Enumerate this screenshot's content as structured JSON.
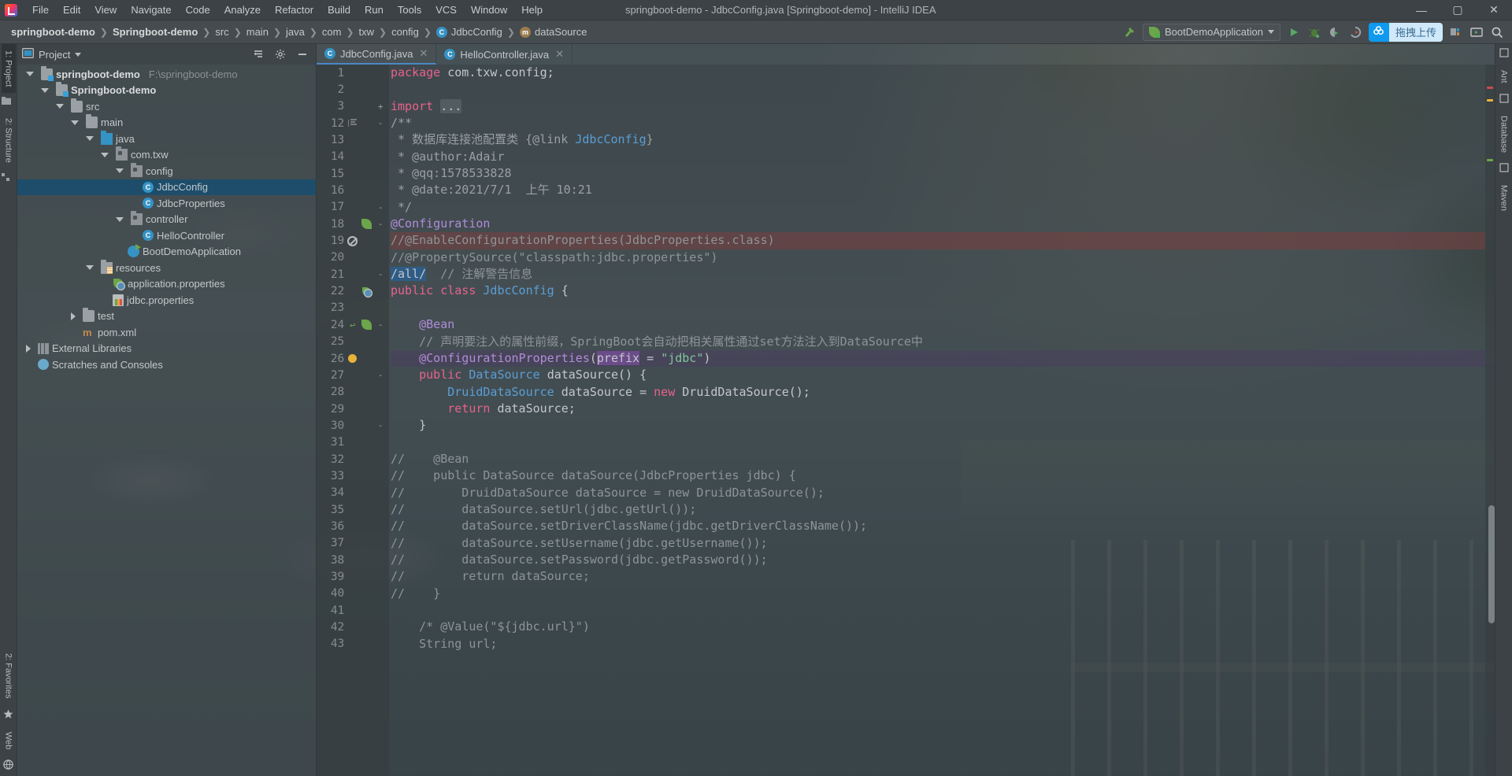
{
  "window": {
    "title": "springboot-demo - JdbcConfig.java [Springboot-demo] - IntelliJ IDEA",
    "minimize": "—",
    "maximize": "▢",
    "close": "✕"
  },
  "menu": [
    {
      "label": "File"
    },
    {
      "label": "Edit"
    },
    {
      "label": "View"
    },
    {
      "label": "Navigate"
    },
    {
      "label": "Code"
    },
    {
      "label": "Analyze"
    },
    {
      "label": "Refactor"
    },
    {
      "label": "Build"
    },
    {
      "label": "Run"
    },
    {
      "label": "Tools"
    },
    {
      "label": "VCS"
    },
    {
      "label": "Window"
    },
    {
      "label": "Help"
    }
  ],
  "breadcrumb": [
    {
      "label": "springboot-demo",
      "icon": "none",
      "bold": true
    },
    {
      "label": "Springboot-demo",
      "icon": "none",
      "bold": true
    },
    {
      "label": "src",
      "icon": "none",
      "bold": false
    },
    {
      "label": "main",
      "icon": "none",
      "bold": false
    },
    {
      "label": "java",
      "icon": "none",
      "bold": false
    },
    {
      "label": "com",
      "icon": "none",
      "bold": false
    },
    {
      "label": "txw",
      "icon": "none",
      "bold": false
    },
    {
      "label": "config",
      "icon": "none",
      "bold": false
    },
    {
      "label": "JdbcConfig",
      "icon": "class-icon",
      "bold": false
    },
    {
      "label": "dataSource",
      "icon": "method-icon",
      "bold": false
    }
  ],
  "toolbar": {
    "build_icon": "hammer-icon",
    "run_config": "BootDemoApplication",
    "run_icon": "run-icon",
    "debug_icon": "debug-icon",
    "coverage_icon": "coverage-icon",
    "profile_icon": "profile-icon",
    "upload_badge": "拖拽上传",
    "upload_icon": "cloud-upload-icon",
    "project_structure_icon": "project-structure-icon",
    "updates_icon": "updates-icon",
    "search_icon": "search-icon"
  },
  "left_rail": {
    "top": [
      {
        "label": "1: Project",
        "active": true,
        "icon": "project-icon"
      },
      {
        "label": "2: Structure",
        "active": false,
        "icon": "structure-icon"
      }
    ],
    "bottom": [
      {
        "label": "2: Favorites",
        "icon": "star-icon"
      },
      {
        "label": "Web",
        "icon": "globe-icon"
      }
    ]
  },
  "right_rail": {
    "items": [
      {
        "label": "Ant",
        "icon": "ant-icon"
      },
      {
        "label": "Database",
        "icon": "database-icon"
      },
      {
        "label": "Maven",
        "icon": "maven-icon"
      }
    ]
  },
  "project_panel": {
    "header": {
      "title": "Project",
      "dropdown_icon": "chevron-down-icon",
      "collapse_icon": "collapse-all-icon",
      "settings_icon": "gear-icon",
      "hide_icon": "hide-icon"
    },
    "tree": [
      {
        "depth": 0,
        "label": "springboot-demo",
        "path": "F:\\springboot-demo",
        "icon": "module-folder-icon",
        "twisty": "open",
        "bold": true,
        "selected": false
      },
      {
        "depth": 1,
        "label": "Springboot-demo",
        "path": "",
        "icon": "module-folder-icon",
        "twisty": "open",
        "bold": true,
        "selected": false
      },
      {
        "depth": 2,
        "label": "src",
        "path": "",
        "icon": "folder-icon",
        "twisty": "open",
        "bold": false,
        "selected": false
      },
      {
        "depth": 3,
        "label": "main",
        "path": "",
        "icon": "folder-icon",
        "twisty": "open",
        "bold": false,
        "selected": false
      },
      {
        "depth": 4,
        "label": "java",
        "path": "",
        "icon": "source-folder-icon",
        "twisty": "open",
        "bold": false,
        "selected": false
      },
      {
        "depth": 5,
        "label": "com.txw",
        "path": "",
        "icon": "package-icon",
        "twisty": "open",
        "bold": false,
        "selected": false
      },
      {
        "depth": 6,
        "label": "config",
        "path": "",
        "icon": "package-icon",
        "twisty": "open",
        "bold": false,
        "selected": false
      },
      {
        "depth": 7,
        "label": "JdbcConfig",
        "path": "",
        "icon": "class-icon",
        "twisty": "none",
        "bold": false,
        "selected": true
      },
      {
        "depth": 7,
        "label": "JdbcProperties",
        "path": "",
        "icon": "class-icon",
        "twisty": "none",
        "bold": false,
        "selected": false
      },
      {
        "depth": 6,
        "label": "controller",
        "path": "",
        "icon": "package-icon",
        "twisty": "open",
        "bold": false,
        "selected": false
      },
      {
        "depth": 7,
        "label": "HelloController",
        "path": "",
        "icon": "class-icon",
        "twisty": "none",
        "bold": false,
        "selected": false
      },
      {
        "depth": 6,
        "label": "BootDemoApplication",
        "path": "",
        "icon": "springboot-app-icon",
        "twisty": "none",
        "bold": false,
        "selected": false
      },
      {
        "depth": 4,
        "label": "resources",
        "path": "",
        "icon": "resources-folder-icon",
        "twisty": "open",
        "bold": false,
        "selected": false
      },
      {
        "depth": 5,
        "label": "application.properties",
        "path": "",
        "icon": "spring-props-icon",
        "twisty": "none",
        "bold": false,
        "selected": false
      },
      {
        "depth": 5,
        "label": "jdbc.properties",
        "path": "",
        "icon": "properties-icon",
        "twisty": "none",
        "bold": false,
        "selected": false
      },
      {
        "depth": 3,
        "label": "test",
        "path": "",
        "icon": "folder-icon",
        "twisty": "closed",
        "bold": false,
        "selected": false
      },
      {
        "depth": 3,
        "label": "pom.xml",
        "path": "",
        "icon": "maven-icon",
        "twisty": "none",
        "bold": false,
        "selected": false
      },
      {
        "depth": 0,
        "label": "External Libraries",
        "path": "",
        "icon": "library-icon",
        "twisty": "closed",
        "bold": false,
        "selected": false
      },
      {
        "depth": 0,
        "label": "Scratches and Consoles",
        "path": "",
        "icon": "scratch-icon",
        "twisty": "none",
        "bold": false,
        "selected": false
      }
    ]
  },
  "editor": {
    "tabs": [
      {
        "label": "JdbcConfig.java",
        "active": true,
        "icon": "class-icon",
        "close": "✕"
      },
      {
        "label": "HelloController.java",
        "active": false,
        "icon": "class-icon",
        "close": "✕"
      }
    ],
    "lines": [
      {
        "num": "1",
        "marks": [],
        "fold": "",
        "hl": "",
        "tokens": [
          {
            "t": "package ",
            "c": "kw"
          },
          {
            "t": "com.txw.config;",
            "c": "fn"
          }
        ]
      },
      {
        "num": "2",
        "marks": [],
        "fold": "",
        "hl": "",
        "tokens": []
      },
      {
        "num": "3",
        "marks": [],
        "fold": "+",
        "hl": "",
        "tokens": [
          {
            "t": "import ",
            "c": "kw"
          },
          {
            "t": "...",
            "c": "folded"
          }
        ]
      },
      {
        "num": "12",
        "marks": [
          "doc-align"
        ],
        "fold": "-",
        "hl": "",
        "tokens": [
          {
            "t": "/**",
            "c": "cmt-doc"
          }
        ]
      },
      {
        "num": "13",
        "marks": [],
        "fold": "",
        "hl": "",
        "tokens": [
          {
            "t": " * ",
            "c": "cmt-doc"
          },
          {
            "t": "数据库连接池配置类 ",
            "c": "cmt-doc"
          },
          {
            "t": "{@link ",
            "c": "cmt-doc"
          },
          {
            "t": "JdbcConfig",
            "c": "cls"
          },
          {
            "t": "}",
            "c": "cmt-doc"
          }
        ]
      },
      {
        "num": "14",
        "marks": [],
        "fold": "",
        "hl": "",
        "tokens": [
          {
            "t": " * @author:Adair",
            "c": "cmt-doc"
          }
        ]
      },
      {
        "num": "15",
        "marks": [],
        "fold": "",
        "hl": "",
        "tokens": [
          {
            "t": " * @qq:1578533828",
            "c": "cmt-doc"
          }
        ]
      },
      {
        "num": "16",
        "marks": [],
        "fold": "",
        "hl": "",
        "tokens": [
          {
            "t": " * @date:2021/7/1  上午 10:21",
            "c": "cmt-doc"
          }
        ]
      },
      {
        "num": "17",
        "marks": [],
        "fold": "-",
        "hl": "",
        "tokens": [
          {
            "t": " */",
            "c": "cmt-doc"
          }
        ]
      },
      {
        "num": "18",
        "marks": [
          "leaf"
        ],
        "fold": "-",
        "hl": "",
        "tokens": [
          {
            "t": "@Configuration",
            "c": "ann"
          }
        ]
      },
      {
        "num": "19",
        "marks": [
          "nosign"
        ],
        "fold": "",
        "hl": "hl-err",
        "tokens": [
          {
            "t": "//@EnableConfigurationProperties(JdbcProperties.class)",
            "c": "cmt"
          }
        ]
      },
      {
        "num": "20",
        "marks": [],
        "fold": "",
        "hl": "",
        "tokens": [
          {
            "t": "//@PropertySource(\"classpath:jdbc.properties\")",
            "c": "cmt"
          }
        ]
      },
      {
        "num": "21",
        "marks": [],
        "fold": "-",
        "hl": "",
        "tokens": [
          {
            "t": "/all/",
            "c": "sel"
          },
          {
            "t": "  ",
            "c": "fn"
          },
          {
            "t": "// 注解警告信息",
            "c": "cmt"
          }
        ]
      },
      {
        "num": "22",
        "marks": [
          "spring"
        ],
        "fold": "",
        "hl": "",
        "tokens": [
          {
            "t": "public ",
            "c": "kw"
          },
          {
            "t": "class ",
            "c": "kw"
          },
          {
            "t": "JdbcConfig",
            "c": "cls"
          },
          {
            "t": " {",
            "c": "punc"
          }
        ]
      },
      {
        "num": "23",
        "marks": [],
        "fold": "",
        "hl": "",
        "tokens": []
      },
      {
        "num": "24",
        "marks": [
          "arrow",
          "leaf"
        ],
        "fold": "-",
        "hl": "",
        "tokens": [
          {
            "t": "    @Bean",
            "c": "ann"
          }
        ]
      },
      {
        "num": "25",
        "marks": [],
        "fold": "",
        "hl": "",
        "tokens": [
          {
            "t": "    // 声明要注入的属性前缀，SpringBoot会自动把相关属性通过set方法注入到DataSource中",
            "c": "cmt"
          }
        ]
      },
      {
        "num": "26",
        "marks": [
          "bulb"
        ],
        "fold": "",
        "hl": "hl-caret",
        "tokens": [
          {
            "t": "    @ConfigurationProperties",
            "c": "ann"
          },
          {
            "t": "(",
            "c": "punc"
          },
          {
            "t": "prefix",
            "c": "boxsel"
          },
          {
            "t": " = ",
            "c": "punc"
          },
          {
            "t": "\"jdbc\"",
            "c": "str"
          },
          {
            "t": ")",
            "c": "punc"
          }
        ]
      },
      {
        "num": "27",
        "marks": [],
        "fold": "-",
        "hl": "",
        "tokens": [
          {
            "t": "    public ",
            "c": "kw"
          },
          {
            "t": "DataSource ",
            "c": "cls"
          },
          {
            "t": "dataSource",
            "c": "fn"
          },
          {
            "t": "() {",
            "c": "punc"
          }
        ]
      },
      {
        "num": "28",
        "marks": [],
        "fold": "",
        "hl": "",
        "tokens": [
          {
            "t": "        DruidDataSource ",
            "c": "cls"
          },
          {
            "t": "dataSource = ",
            "c": "fn"
          },
          {
            "t": "new ",
            "c": "kw"
          },
          {
            "t": "DruidDataSource();",
            "c": "fn"
          }
        ]
      },
      {
        "num": "29",
        "marks": [],
        "fold": "",
        "hl": "",
        "tokens": [
          {
            "t": "        return ",
            "c": "kw"
          },
          {
            "t": "dataSource;",
            "c": "fn"
          }
        ]
      },
      {
        "num": "30",
        "marks": [],
        "fold": "-",
        "hl": "",
        "tokens": [
          {
            "t": "    }",
            "c": "punc"
          }
        ]
      },
      {
        "num": "31",
        "marks": [],
        "fold": "",
        "hl": "",
        "tokens": []
      },
      {
        "num": "32",
        "marks": [],
        "fold": "",
        "hl": "",
        "tokens": [
          {
            "t": "//    @Bean",
            "c": "cmt"
          }
        ]
      },
      {
        "num": "33",
        "marks": [],
        "fold": "",
        "hl": "",
        "tokens": [
          {
            "t": "//    public DataSource dataSource(JdbcProperties jdbc) {",
            "c": "cmt"
          }
        ]
      },
      {
        "num": "34",
        "marks": [],
        "fold": "",
        "hl": "",
        "tokens": [
          {
            "t": "//        DruidDataSource dataSource = new DruidDataSource();",
            "c": "cmt"
          }
        ]
      },
      {
        "num": "35",
        "marks": [],
        "fold": "",
        "hl": "",
        "tokens": [
          {
            "t": "//        dataSource.setUrl(jdbc.getUrl());",
            "c": "cmt"
          }
        ]
      },
      {
        "num": "36",
        "marks": [],
        "fold": "",
        "hl": "",
        "tokens": [
          {
            "t": "//        dataSource.setDriverClassName(jdbc.getDriverClassName());",
            "c": "cmt"
          }
        ]
      },
      {
        "num": "37",
        "marks": [],
        "fold": "",
        "hl": "",
        "tokens": [
          {
            "t": "//        dataSource.setUsername(jdbc.getUsername());",
            "c": "cmt"
          }
        ]
      },
      {
        "num": "38",
        "marks": [],
        "fold": "",
        "hl": "",
        "tokens": [
          {
            "t": "//        dataSource.setPassword(jdbc.getPassword());",
            "c": "cmt"
          }
        ]
      },
      {
        "num": "39",
        "marks": [],
        "fold": "",
        "hl": "",
        "tokens": [
          {
            "t": "//        return dataSource;",
            "c": "cmt"
          }
        ]
      },
      {
        "num": "40",
        "marks": [],
        "fold": "",
        "hl": "",
        "tokens": [
          {
            "t": "//    }",
            "c": "cmt"
          }
        ]
      },
      {
        "num": "41",
        "marks": [],
        "fold": "",
        "hl": "",
        "tokens": []
      },
      {
        "num": "42",
        "marks": [],
        "fold": "",
        "hl": "",
        "tokens": [
          {
            "t": "    /* @Value(\"${jdbc.url}\")",
            "c": "cmt"
          }
        ]
      },
      {
        "num": "43",
        "marks": [],
        "fold": "",
        "hl": "",
        "tokens": [
          {
            "t": "    String url;",
            "c": "cmt"
          }
        ]
      }
    ]
  },
  "colors": {
    "accent_blue": "#3592c4",
    "selection_blue": "#1d4d6b",
    "error_red": "#7a3e3e",
    "caret_line": "#4a3e5c",
    "keyword_pink": "#e8628c",
    "annotation_purple": "#b18cd9",
    "string_green": "#7ec699",
    "comment_grey": "#8e9496",
    "upload_badge_blue": "#0f9aef"
  }
}
